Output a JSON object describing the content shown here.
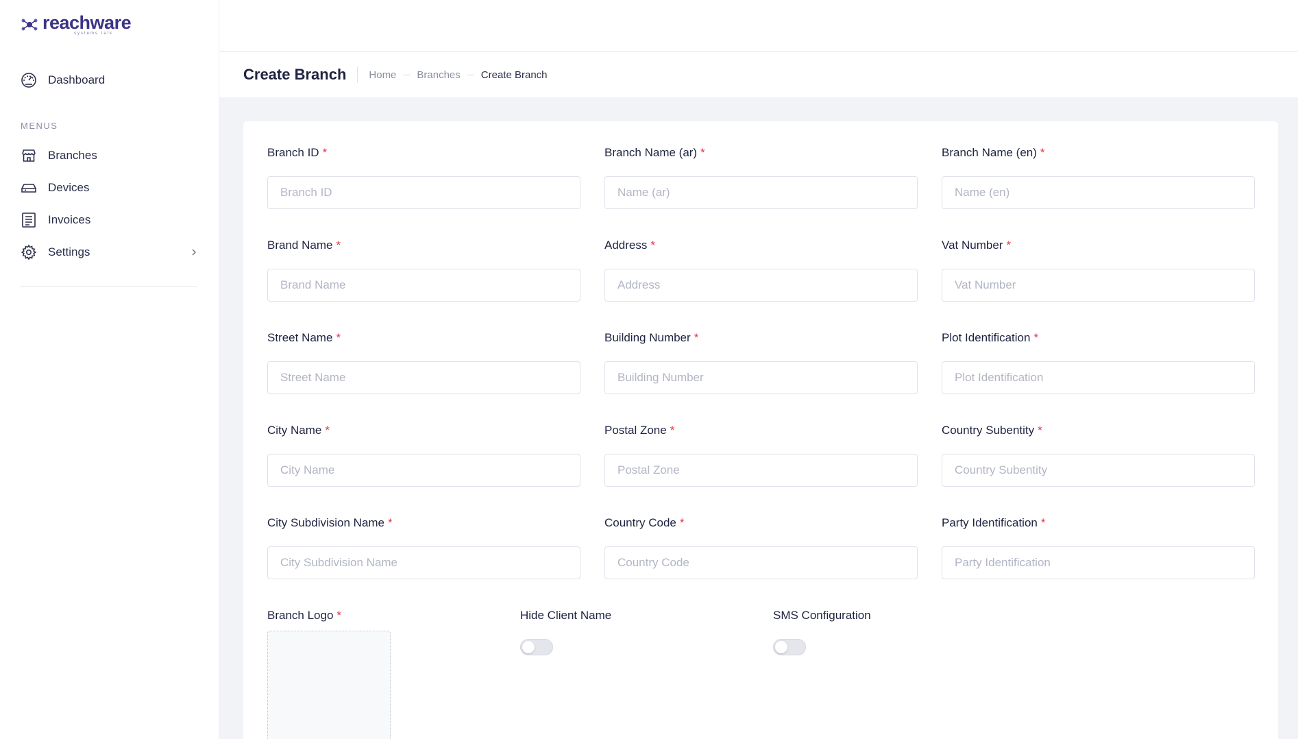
{
  "brand": {
    "name": "reachware",
    "tagline": "systems talk",
    "accent": "#3b3486"
  },
  "sidebar": {
    "dashboard": {
      "label": "Dashboard",
      "icon": "dashboard-gauge-icon"
    },
    "menus_label": "MENUS",
    "items": [
      {
        "label": "Branches",
        "icon": "storefront-icon"
      },
      {
        "label": "Devices",
        "icon": "device-icon"
      },
      {
        "label": "Invoices",
        "icon": "invoice-icon"
      },
      {
        "label": "Settings",
        "icon": "gear-icon",
        "has_submenu": true
      }
    ]
  },
  "header": {
    "title": "Create Branch",
    "breadcrumb": [
      "Home",
      "Branches",
      "Create Branch"
    ]
  },
  "form": {
    "fields": [
      {
        "label": "Branch ID",
        "placeholder": "Branch ID",
        "value": "",
        "required": true
      },
      {
        "label": "Branch Name (ar)",
        "placeholder": "Name (ar)",
        "value": "",
        "required": true
      },
      {
        "label": "Branch Name (en)",
        "placeholder": "Name (en)",
        "value": "",
        "required": true
      },
      {
        "label": "Brand Name",
        "placeholder": "Brand Name",
        "value": "",
        "required": true
      },
      {
        "label": "Address",
        "placeholder": "Address",
        "value": "",
        "required": true
      },
      {
        "label": "Vat Number",
        "placeholder": "Vat Number",
        "value": "",
        "required": true
      },
      {
        "label": "Street Name",
        "placeholder": "Street Name",
        "value": "",
        "required": true
      },
      {
        "label": "Building Number",
        "placeholder": "Building Number",
        "value": "",
        "required": true
      },
      {
        "label": "Plot Identification",
        "placeholder": "Plot Identification",
        "value": "",
        "required": true
      },
      {
        "label": "City Name",
        "placeholder": "City Name",
        "value": "",
        "required": true
      },
      {
        "label": "Postal Zone",
        "placeholder": "Postal Zone",
        "value": "",
        "required": true
      },
      {
        "label": "Country Subentity",
        "placeholder": "Country Subentity",
        "value": "",
        "required": true
      },
      {
        "label": "City Subdivision Name",
        "placeholder": "City Subdivision Name",
        "value": "",
        "required": true
      },
      {
        "label": "Country Code",
        "placeholder": "Country Code",
        "value": "",
        "required": true
      },
      {
        "label": "Party Identification",
        "placeholder": "Party Identification",
        "value": "",
        "required": true
      }
    ],
    "required_marker": "*",
    "branch_logo": {
      "label": "Branch Logo",
      "required": true
    },
    "toggles": [
      {
        "label": "Hide Client Name",
        "on": false
      },
      {
        "label": "SMS Configuration",
        "on": false
      }
    ]
  }
}
